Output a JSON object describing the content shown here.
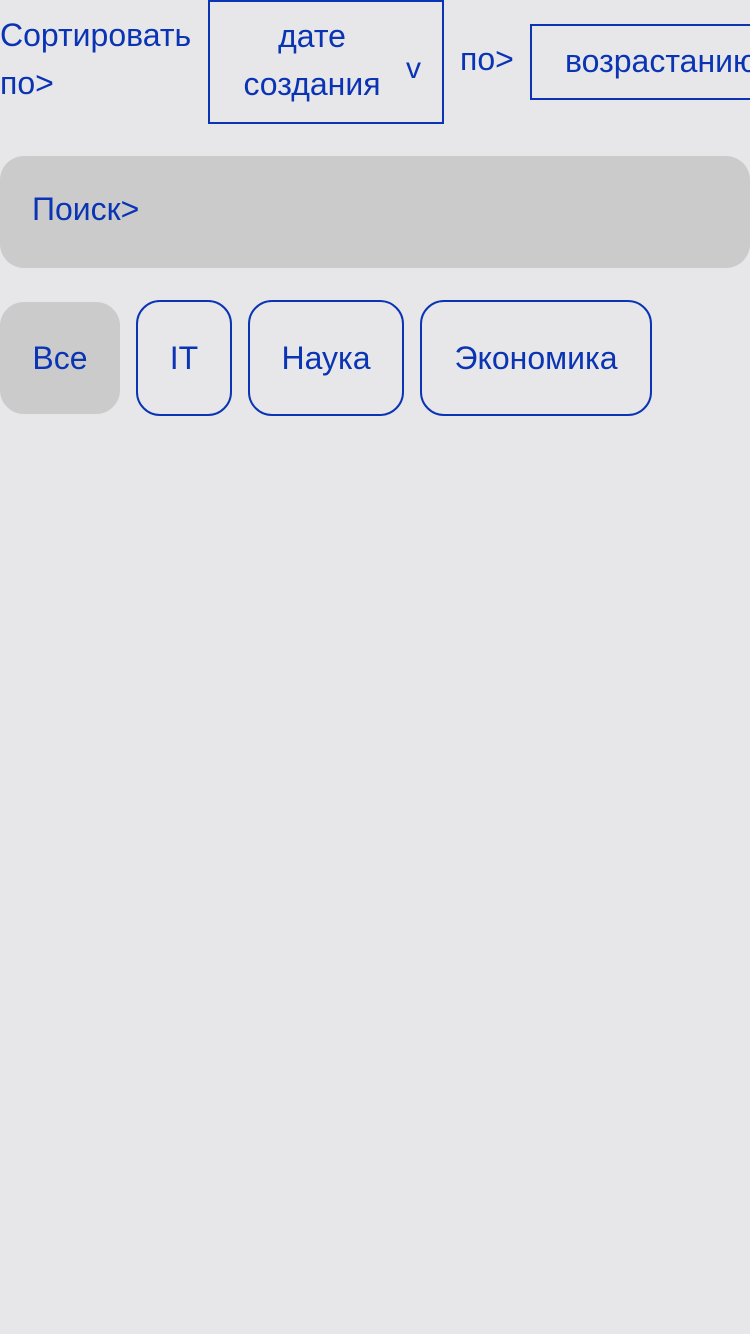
{
  "sort": {
    "label": "Сортировать по>",
    "field_value": "дате создания",
    "chevron": "v",
    "order_label": "по>",
    "order_value": "возрастанию"
  },
  "search": {
    "label": "Поиск>"
  },
  "filters": [
    {
      "label": "Все",
      "active": true
    },
    {
      "label": "IT",
      "active": false
    },
    {
      "label": "Наука",
      "active": false
    },
    {
      "label": "Экономика",
      "active": false
    }
  ],
  "colors": {
    "text_accent": "#0a34b4",
    "background": "#e7e7ea",
    "surface": "#cbcbcb"
  }
}
